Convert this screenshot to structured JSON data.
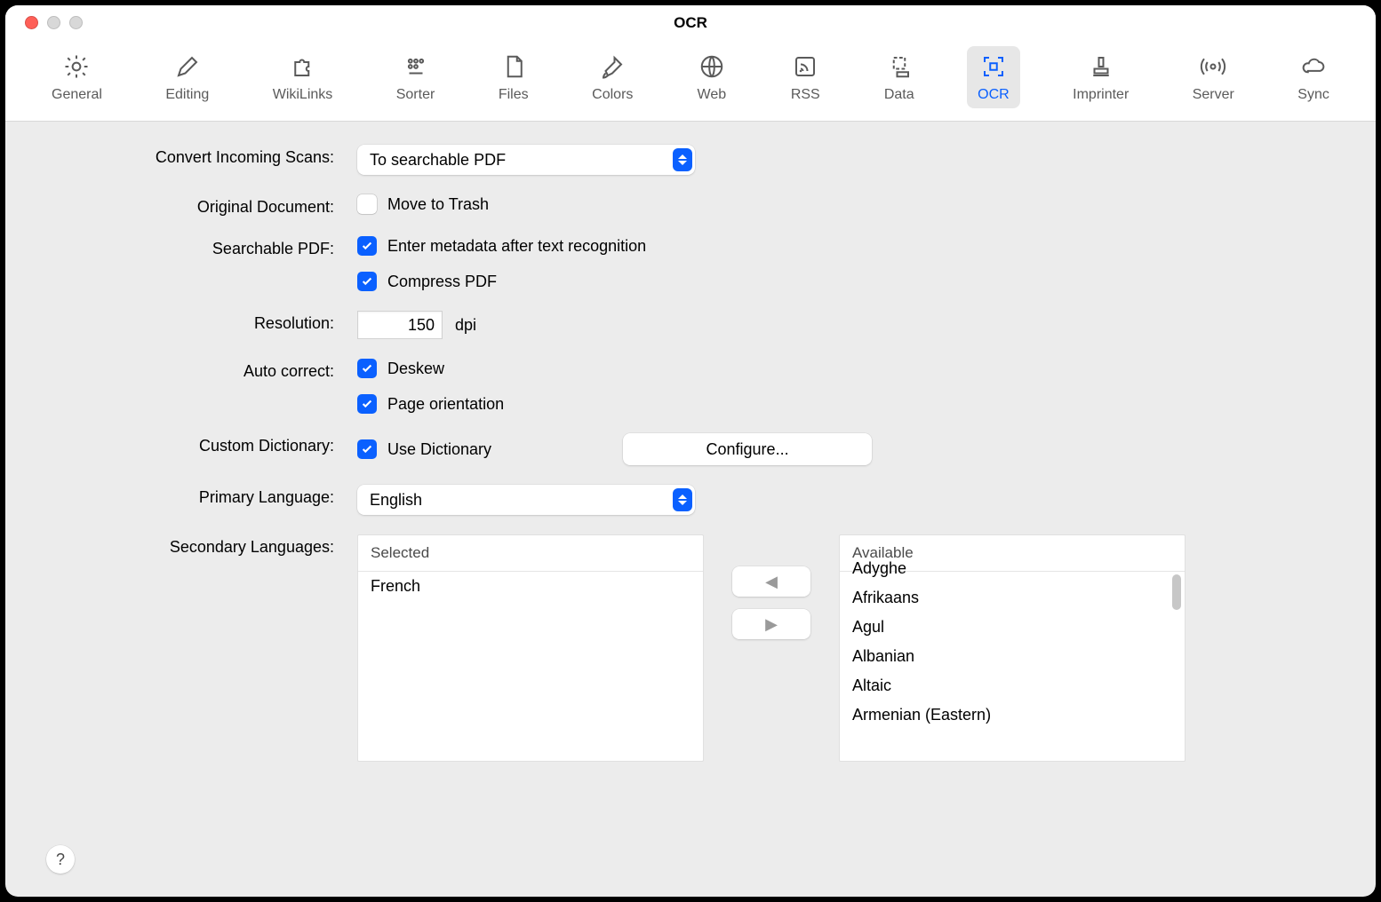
{
  "window": {
    "title": "OCR"
  },
  "toolbar": {
    "items": [
      {
        "key": "general",
        "label": "General"
      },
      {
        "key": "editing",
        "label": "Editing"
      },
      {
        "key": "wikilinks",
        "label": "WikiLinks"
      },
      {
        "key": "sorter",
        "label": "Sorter"
      },
      {
        "key": "files",
        "label": "Files"
      },
      {
        "key": "colors",
        "label": "Colors"
      },
      {
        "key": "web",
        "label": "Web"
      },
      {
        "key": "rss",
        "label": "RSS"
      },
      {
        "key": "data",
        "label": "Data"
      },
      {
        "key": "ocr",
        "label": "OCR"
      },
      {
        "key": "imprinter",
        "label": "Imprinter"
      },
      {
        "key": "server",
        "label": "Server"
      },
      {
        "key": "sync",
        "label": "Sync"
      }
    ],
    "active": "ocr"
  },
  "labels": {
    "convert_incoming": "Convert Incoming Scans:",
    "original_document": "Original Document:",
    "searchable_pdf": "Searchable PDF:",
    "resolution": "Resolution:",
    "auto_correct": "Auto correct:",
    "custom_dictionary": "Custom Dictionary:",
    "primary_language": "Primary Language:",
    "secondary_languages": "Secondary Languages:"
  },
  "values": {
    "convert_incoming": "To searchable PDF",
    "move_to_trash_label": "Move to Trash",
    "move_to_trash_checked": false,
    "enter_metadata_label": "Enter metadata after text recognition",
    "enter_metadata_checked": true,
    "compress_pdf_label": "Compress PDF",
    "compress_pdf_checked": true,
    "resolution_value": "150",
    "resolution_unit": "dpi",
    "deskew_label": "Deskew",
    "deskew_checked": true,
    "page_orientation_label": "Page orientation",
    "page_orientation_checked": true,
    "use_dictionary_label": "Use Dictionary",
    "use_dictionary_checked": true,
    "configure_label": "Configure...",
    "primary_language": "English"
  },
  "secondary": {
    "selected_header": "Selected",
    "available_header": "Available",
    "selected": [
      "French"
    ],
    "available": [
      "Adyghe",
      "Afrikaans",
      "Agul",
      "Albanian",
      "Altaic",
      "Armenian (Eastern)"
    ]
  },
  "help_label": "?"
}
